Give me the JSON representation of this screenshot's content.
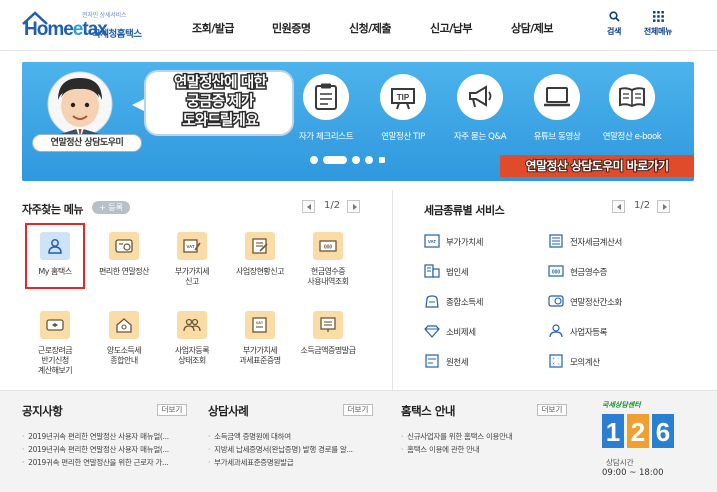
{
  "header": {
    "logo_tagline": "전자민 상세서비스",
    "logo_home": "Home",
    "logo_tax_e": "e",
    "logo_tax_rest": "tax",
    "logo_sub": "국세청홈택스",
    "nav": [
      "조회/발급",
      "민원증명",
      "신청/제출",
      "신고/납부",
      "상담/제보"
    ],
    "search_label": "검색",
    "all_menu_label": "전체메뉴"
  },
  "banner": {
    "mascot_label": "연말정산 상담도우미",
    "speech": "연말정산에 대한\n궁금증 제가\n도와드릴게요",
    "icons": [
      {
        "label": "자가 체크리스트",
        "icon": "checklist-icon"
      },
      {
        "label": "연말정산 TIP",
        "icon": "tip-icon",
        "text": "TIP"
      },
      {
        "label": "자주 묻는 Q&A",
        "icon": "megaphone-icon"
      },
      {
        "label": "유튜브 동영상",
        "icon": "laptop-icon"
      },
      {
        "label": "연말정산 e-book",
        "icon": "book-icon"
      }
    ],
    "shortcut_button": "연말정산 상담도우미 바로가기",
    "colors": {
      "background": "#3fa7e6",
      "shortcut": "#e04c2b"
    }
  },
  "quick_menu": {
    "title": "자주찾는 메뉴",
    "register_button": "+ 등록",
    "page": "1/2",
    "items": [
      {
        "label": "My 홈택스",
        "icon": "user-icon",
        "selected": true
      },
      {
        "label": "편리한 연말정산",
        "icon": "calculator-icon"
      },
      {
        "label": "부가가치세\n신고",
        "icon": "vat-icon"
      },
      {
        "label": "사업장현황신고",
        "icon": "document-icon"
      },
      {
        "label": "현금영수증\n사용내역조회",
        "icon": "receipt-icon"
      },
      {
        "label": "근로장려금\n반기신청\n계산해보기",
        "icon": "wallet-icon"
      },
      {
        "label": "양도소득세\n종합안내",
        "icon": "house-icon"
      },
      {
        "label": "사업자등록\n상태조회",
        "icon": "people-icon"
      },
      {
        "label": "부가가치세\n과세표준증명",
        "icon": "certificate-icon"
      },
      {
        "label": "소득금액증명발급",
        "icon": "monitor-icon"
      }
    ]
  },
  "tax_services": {
    "title": "세금종류별 서비스",
    "page": "1/2",
    "items": [
      {
        "label": "부가가치세",
        "icon": "vat-icon"
      },
      {
        "label": "전자세금계산서",
        "icon": "invoice-icon"
      },
      {
        "label": "법인세",
        "icon": "corporate-icon"
      },
      {
        "label": "현금영수증",
        "icon": "cash-receipt-icon"
      },
      {
        "label": "종합소득세",
        "icon": "income-icon"
      },
      {
        "label": "연말정산간소화",
        "icon": "simplify-icon"
      },
      {
        "label": "소비제세",
        "icon": "diamond-icon"
      },
      {
        "label": "사업자등록",
        "icon": "person-icon"
      },
      {
        "label": "원천세",
        "icon": "withholding-icon"
      },
      {
        "label": "모의계산",
        "icon": "calculator-icon"
      }
    ]
  },
  "notices": {
    "title": "공지사항",
    "more": "더보기",
    "items": [
      "2019년귀속 편리한 연말정산 사용자 매뉴얼(...",
      "2019년귀속 편리한 연말정산 사용자 매뉴얼(...",
      "2019귀속 편리한 연말정산을 위한 근로자 가..."
    ]
  },
  "consult_cases": {
    "title": "상담사례",
    "more": "더보기",
    "items": [
      "소득금액 증명원에 대하여",
      "지방세 납세증명서(완납증명) 발행 경로를 알...",
      "부가세과세표준증명원발급"
    ]
  },
  "hometax_guide": {
    "title": "홈택스 안내",
    "more": "더보기",
    "items": [
      "신규사업자를 위한 홈택스 이용안내",
      "홈택스 이용에 관한 안내"
    ]
  },
  "call_center": {
    "tagline": "국세상담센터",
    "number": "126",
    "hours_label": "상담시간",
    "hours": "09:00 ~ 18:00",
    "colors": {
      "number_blue": "#2a7fd1",
      "number_orange": "#f0a030"
    }
  }
}
